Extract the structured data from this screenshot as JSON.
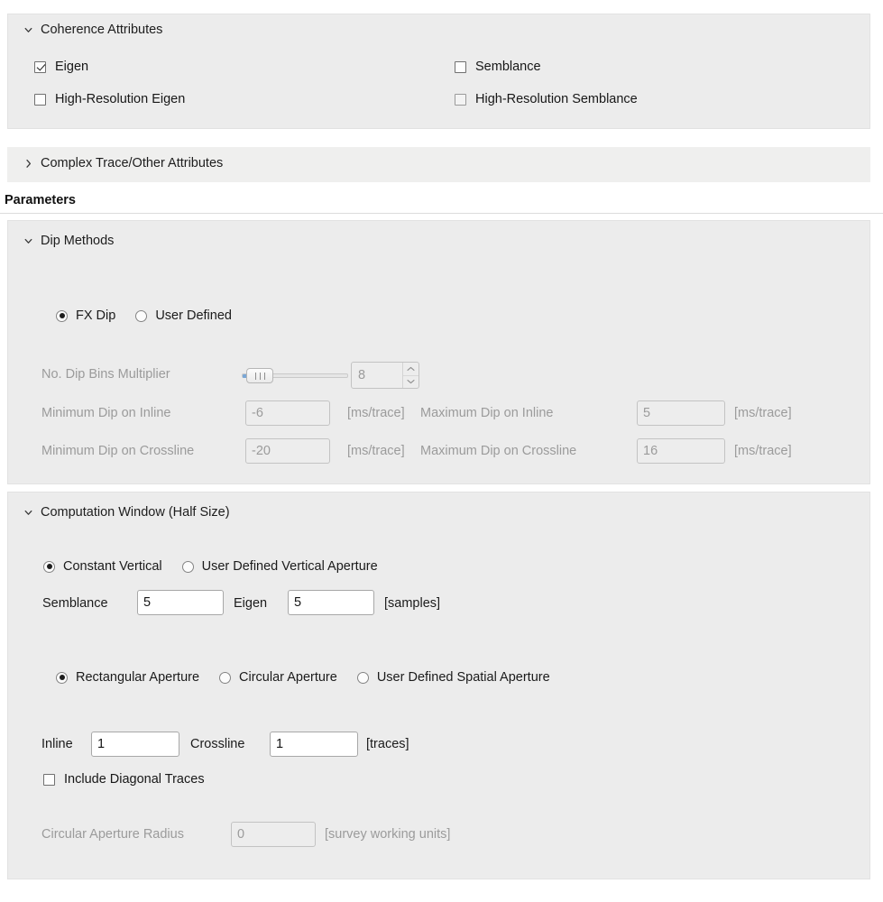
{
  "panels": {
    "coherence": {
      "title": "Coherence Attributes",
      "expanded": true,
      "chevron": "chevron-down-icon",
      "options": [
        {
          "label": "Eigen",
          "checked": true,
          "enabled": true
        },
        {
          "label": "Semblance",
          "checked": false,
          "enabled": true
        },
        {
          "label": "High-Resolution Eigen",
          "checked": false,
          "enabled": true
        },
        {
          "label": "High-Resolution Semblance",
          "checked": false,
          "enabled": false
        }
      ]
    },
    "complex_trace": {
      "title": "Complex Trace/Other Attributes",
      "expanded": false,
      "chevron": "chevron-right-icon"
    },
    "parameters_heading": "Parameters",
    "dip_methods": {
      "title": "Dip Methods",
      "expanded": true,
      "chevron": "chevron-down-icon",
      "method_radios": [
        {
          "label": "FX Dip",
          "selected": true
        },
        {
          "label": "User Defined",
          "selected": false
        }
      ],
      "dip_bins": {
        "label": "No. Dip Bins Multiplier",
        "value": "8",
        "enabled": false,
        "slider_position_percent": 5
      },
      "dip_limits": [
        {
          "min_label": "Minimum Dip on Inline",
          "min_value": "-6",
          "min_unit": "[ms/trace]",
          "max_label": "Maximum Dip on Inline",
          "max_value": "5",
          "max_unit": "[ms/trace]",
          "enabled": false
        },
        {
          "min_label": "Minimum Dip on Crossline",
          "min_value": "-20",
          "min_unit": "[ms/trace]",
          "max_label": "Maximum Dip on Crossline",
          "max_value": "16",
          "max_unit": "[ms/trace]",
          "enabled": false
        }
      ]
    },
    "computation_window": {
      "title": "Computation Window (Half Size)",
      "expanded": true,
      "chevron": "chevron-down-icon",
      "vertical_radios": [
        {
          "label": "Constant Vertical",
          "selected": true
        },
        {
          "label": "User Defined Vertical Aperture",
          "selected": false
        }
      ],
      "vertical_fields": {
        "semblance_label": "Semblance",
        "semblance_value": "5",
        "eigen_label": "Eigen",
        "eigen_value": "5",
        "unit": "[samples]",
        "enabled": true
      },
      "aperture_radios": [
        {
          "label": "Rectangular Aperture",
          "selected": true
        },
        {
          "label": "Circular Aperture",
          "selected": false
        },
        {
          "label": "User Defined Spatial Aperture",
          "selected": false
        }
      ],
      "spatial_fields": {
        "inline_label": "Inline",
        "inline_value": "1",
        "crossline_label": "Crossline",
        "crossline_value": "1",
        "unit": "[traces]",
        "enabled": true
      },
      "diagonal": {
        "label": "Include Diagonal Traces",
        "checked": false,
        "enabled": true
      },
      "circular_radius": {
        "label": "Circular Aperture Radius",
        "value": "0",
        "unit": "[survey working units]",
        "enabled": false
      }
    }
  },
  "colors": {
    "panel_bg": "#ececec",
    "page_bg": "#ffffff",
    "slider_accent": "#7aa7d6",
    "disabled_text": "#9b9b9b"
  }
}
